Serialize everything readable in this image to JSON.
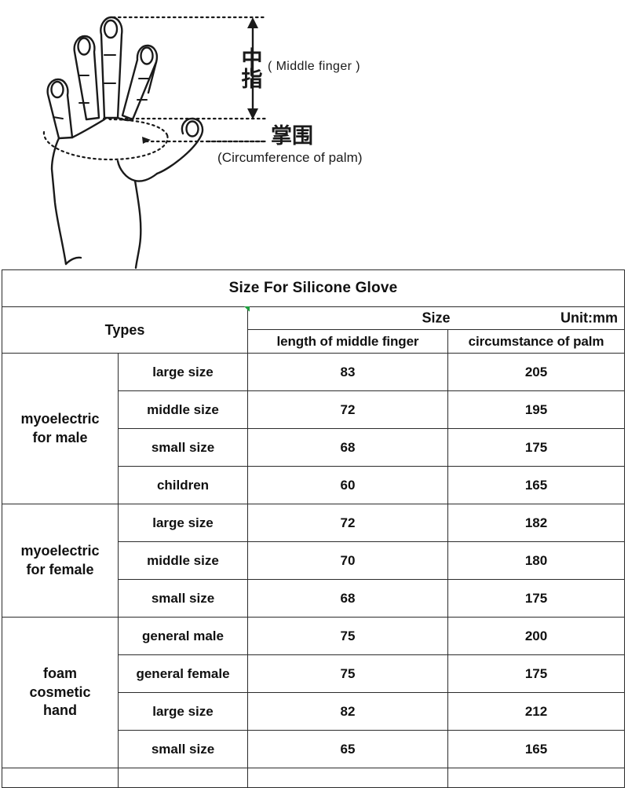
{
  "diagram": {
    "middle_finger_cn": "中指",
    "middle_finger_cn_chars": [
      "中",
      "指"
    ],
    "middle_finger_en": "( Middle  finger )",
    "palm_cn": "掌围",
    "palm_en": "(Circumference of palm)",
    "icons": {
      "hand": "hand-outline-icon",
      "arrow_vertical": "double-arrow-vertical-icon",
      "palm_loop": "palm-circumference-loop-icon"
    }
  },
  "table": {
    "title": "Size For Silicone Glove",
    "types_header": "Types",
    "size_header": "Size",
    "unit_header": "Unit:mm",
    "col_headers": [
      "length of middle finger",
      "circumstance of palm"
    ],
    "groups": [
      {
        "name": "myoelectric\nfor male",
        "name_lines": [
          "myoelectric",
          "for male"
        ],
        "rows": [
          {
            "label": "large size",
            "finger": "83",
            "palm": "205"
          },
          {
            "label": "middle size",
            "finger": "72",
            "palm": "195"
          },
          {
            "label": "small size",
            "finger": "68",
            "palm": "175"
          },
          {
            "label": "children",
            "finger": "60",
            "palm": "165"
          }
        ]
      },
      {
        "name": "myoelectric\nfor female",
        "name_lines": [
          "myoelectric",
          "for female"
        ],
        "rows": [
          {
            "label": "large size",
            "finger": "72",
            "palm": "182"
          },
          {
            "label": "middle size",
            "finger": "70",
            "palm": "180"
          },
          {
            "label": "small size",
            "finger": "68",
            "palm": "175"
          }
        ]
      },
      {
        "name": "foam\ncosmetic\nhand",
        "name_lines": [
          "foam",
          "cosmetic",
          "hand"
        ],
        "rows": [
          {
            "label": "general male",
            "finger": "75",
            "palm": "200"
          },
          {
            "label": "general female",
            "finger": "75",
            "palm": "175"
          },
          {
            "label": "large size",
            "finger": "82",
            "palm": "212"
          },
          {
            "label": "small size",
            "finger": "65",
            "palm": "165"
          }
        ]
      }
    ]
  },
  "colors": {
    "border": "#2b2b2b",
    "text": "#111111",
    "background": "#ffffff",
    "artifact_green": "#1f9e3f"
  }
}
